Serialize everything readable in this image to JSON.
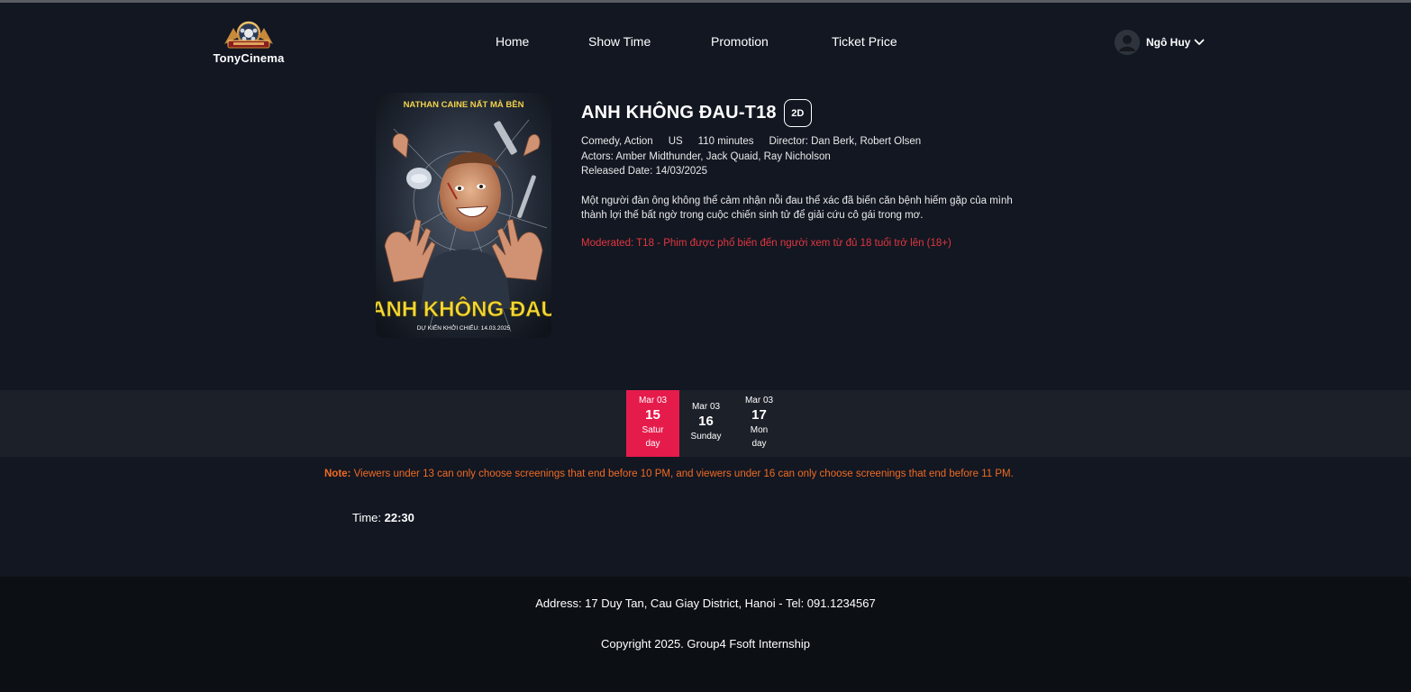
{
  "brand": {
    "name": "TonyCinema"
  },
  "nav": {
    "items": [
      {
        "label": "Home"
      },
      {
        "label": "Show Time"
      },
      {
        "label": "Promotion"
      },
      {
        "label": "Ticket Price"
      }
    ]
  },
  "user": {
    "name": "Ngô Huy",
    "icon": "user-avatar-icon"
  },
  "movie": {
    "title": "ANH KHÔNG ĐAU-T18",
    "format": "2D",
    "genre": "Comedy, Action",
    "country": "US",
    "duration": "110 minutes",
    "director": "Director: Dan Berk, Robert Olsen",
    "actors": "Actors: Amber Midthunder, Jack Quaid, Ray Nicholson",
    "released": "Released Date: 14/03/2025",
    "description": "Một người đàn ông không thể cảm nhận nỗi đau thể xác đã biến căn bệnh hiếm gặp của mình thành lợi thế bất ngờ trong cuộc chiến sinh tử để giải cứu cô gái trong mơ.",
    "moderated": "Moderated: T18 - Phim được phổ biến đến người xem từ đủ 18 tuổi trở lên (18+)",
    "poster": {
      "top_text": "NATHAN CAINE NẤT MÀ BỀN",
      "title_text": "ANH KHÔNG ĐAU",
      "date_text": "DỰ KIẾN KHỞI CHIẾU: 14.03.2025"
    }
  },
  "dates": [
    {
      "month": "Mar 03",
      "day": "15",
      "weekday_line1": "Satur",
      "weekday_line2": "day",
      "selected": true
    },
    {
      "month": "Mar 03",
      "day": "16",
      "weekday_line1": "Sunday",
      "weekday_line2": "",
      "selected": false
    },
    {
      "month": "Mar 03",
      "day": "17",
      "weekday_line1": "Mon",
      "weekday_line2": "day",
      "selected": false
    }
  ],
  "note": {
    "label": "Note:",
    "text": " Viewers under 13 can only choose screenings that end before 10 PM, and viewers under 16 can only choose screenings that end before 11 PM."
  },
  "showtime": {
    "label": "Time: ",
    "value": "22:30"
  },
  "footer": {
    "address": "Address: 17 Duy Tan, Cau Giay District, Hanoi - Tel: 091.1234567",
    "copyright": "Copyright 2025. Group4 Fsoft Internship"
  },
  "colors": {
    "background": "#121722",
    "accent": "#e51b4c",
    "note": "#f06a22",
    "moderated": "#e2373f"
  }
}
